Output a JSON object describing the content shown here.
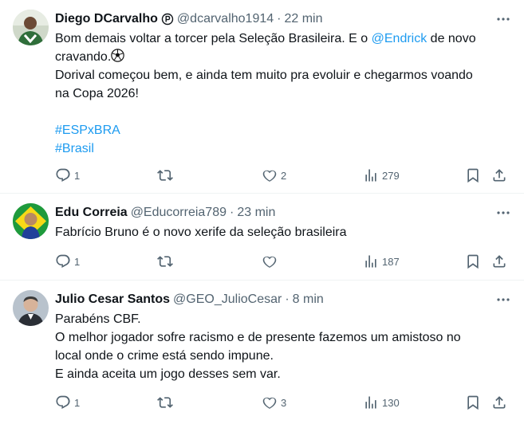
{
  "tweets": [
    {
      "name": "Diego DCarvalho",
      "badge_icon": "parody-badge-icon",
      "handle": "@dcarvalho1914",
      "dot": "·",
      "time": "22 min",
      "lines": {
        "l1_pre": "Bom demais voltar a torcer pela Seleção Brasileira. E o ",
        "l1_mention": "@Endrick",
        "l1_post": " de novo",
        "l2": "cravando.",
        "l3": "Dorival começou bem, e ainda tem muito pra evoluir e chegarmos voando",
        "l4": "na Copa 2026!",
        "tag1": "#ESPxBRA",
        "tag2": "#Brasil"
      },
      "emoji": "soccer-ball-icon",
      "replies": "1",
      "reposts": "",
      "likes": "2",
      "views": "279"
    },
    {
      "name": "Edu Correia",
      "handle": "@Educorreia789",
      "dot": "·",
      "time": "23 min",
      "lines": {
        "l1": "Fabrício Bruno é o novo xerife da seleção brasileira"
      },
      "replies": "1",
      "reposts": "",
      "likes": "",
      "views": "187"
    },
    {
      "name": "Julio Cesar Santos",
      "handle": "@GEO_JulioCesar",
      "dot": "·",
      "time": "8 min",
      "lines": {
        "l1": "Parabéns CBF.",
        "l2": "O melhor jogador sofre racismo e de presente fazemos um amistoso no",
        "l3": "local onde o crime está sendo impune.",
        "l4": "E ainda aceita um jogo desses sem var."
      },
      "replies": "1",
      "reposts": "",
      "likes": "3",
      "views": "130"
    }
  ],
  "colors": {
    "text": "#0f1419",
    "secondary": "#536471",
    "link": "#1d9bf0",
    "divider": "#eff3f4"
  }
}
